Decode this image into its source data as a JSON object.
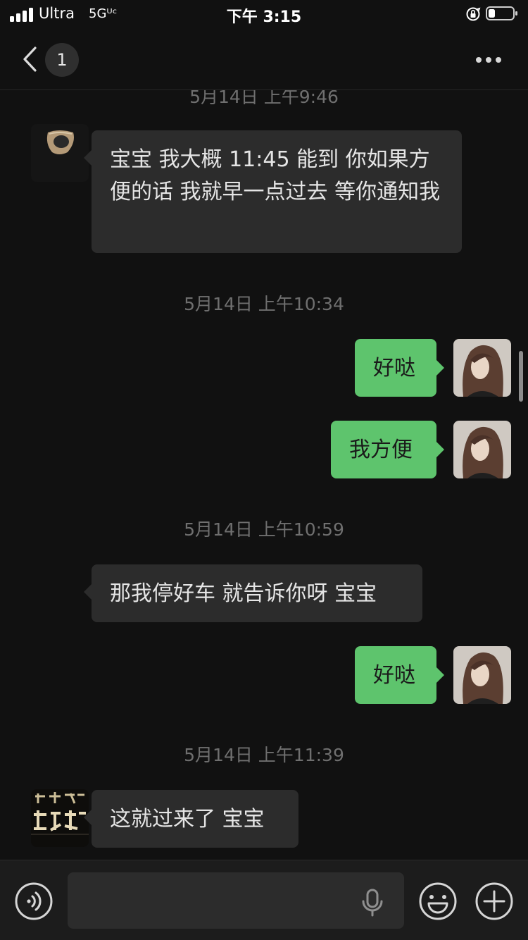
{
  "status_bar": {
    "carrier": "Ultra",
    "network": "5Gᵁᶜ",
    "time": "下午 3:15",
    "icons": [
      "signal-icon",
      "orientation-lock-icon",
      "battery-icon"
    ]
  },
  "nav": {
    "unread_count": "1",
    "title": "",
    "icons": [
      "back-icon",
      "more-icon"
    ]
  },
  "chat": {
    "timestamps": [
      "5月14日 上午9:46",
      "5月14日 上午10:34",
      "5月14日 上午10:59",
      "5月14日 上午11:39"
    ],
    "messages": [
      {
        "sender": "contact",
        "text": "宝宝 我大概 11:45 能到 你如果方便的话 我就早一点过去 等你通知我"
      },
      {
        "sender": "self",
        "text": "好哒"
      },
      {
        "sender": "self",
        "text": "我方便"
      },
      {
        "sender": "contact",
        "text": "那我停好车 就告诉你呀 宝宝"
      },
      {
        "sender": "self",
        "text": "好哒"
      },
      {
        "sender": "contact",
        "text": "这就过来了 宝宝"
      }
    ]
  },
  "input_bar": {
    "placeholder": "",
    "icons": [
      "voice-toggle-icon",
      "mic-icon",
      "emoji-icon",
      "add-icon"
    ]
  },
  "colors": {
    "background": "#111111",
    "incoming_bubble": "#2c2c2c",
    "outgoing_bubble": "#5ec46d",
    "timestamp_text": "#6f6f6f"
  }
}
